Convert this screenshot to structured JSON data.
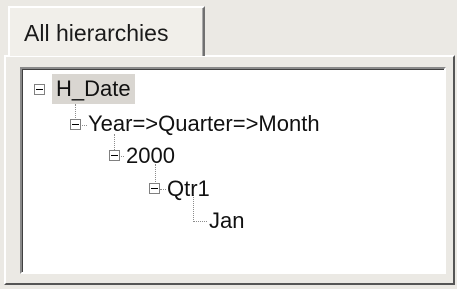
{
  "tab": {
    "label": "All hierarchies"
  },
  "tree": {
    "nodes": [
      {
        "label": "H_Date",
        "selected": true,
        "expanded": true
      },
      {
        "label": "Year=>Quarter=>Month",
        "expanded": true
      },
      {
        "label": "2000",
        "expanded": true
      },
      {
        "label": "Qtr1",
        "expanded": true
      },
      {
        "label": "Jan"
      }
    ]
  },
  "colors": {
    "selection": "#d9d6d1",
    "background": "#ebe9e4"
  }
}
